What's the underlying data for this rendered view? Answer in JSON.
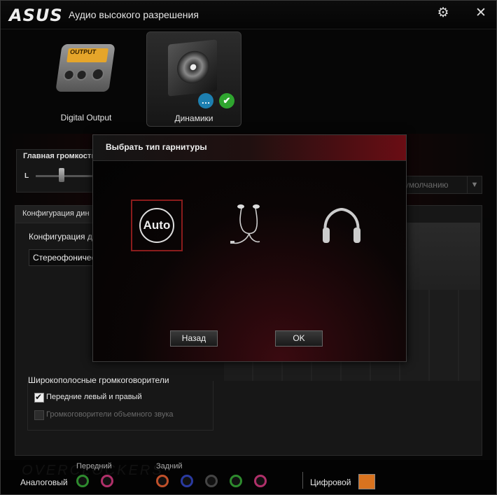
{
  "app": {
    "brand": "ASUS",
    "title": "Аудио высокого разрешения",
    "settings_icon": "gear-icon",
    "close_icon": "close-icon"
  },
  "devices": [
    {
      "label": "Digital Output",
      "screen_text": "OUTPUT"
    },
    {
      "label": "Динамики"
    }
  ],
  "volume": {
    "title": "Главная громкость",
    "left_label": "L"
  },
  "default_dropdown": {
    "label": "о умолчанию"
  },
  "config": {
    "tab_label": "Конфигурация дин",
    "sub_label": "Конфигурация д",
    "select_value": "Стереофоничес"
  },
  "wideband": {
    "title": "Широкополосные громкоговорители",
    "front_label": "Передние левый и правый",
    "front_checked": true,
    "surround_label": "Громкоговорители объемного звука",
    "surround_checked": false
  },
  "bottom": {
    "analog_label": "Аналоговый",
    "front_label": "Передний",
    "rear_label": "Задний",
    "digital_label": "Цифровой",
    "watermark": "OVERCLOCKERS",
    "jack_colors": [
      "#2e8b2e",
      "#b0306a",
      "#c0502a",
      "#2a3aa0",
      "#444444",
      "#2e8b2e",
      "#b0306a"
    ]
  },
  "dialog": {
    "title": "Выбрать тип гарнитуры",
    "options": [
      {
        "label": "Auto",
        "icon": "auto-icon",
        "selected": true
      },
      {
        "icon": "earphones-icon",
        "selected": false
      },
      {
        "icon": "headphones-icon",
        "selected": false
      }
    ],
    "back_button": "Назад",
    "ok_button": "OK"
  }
}
